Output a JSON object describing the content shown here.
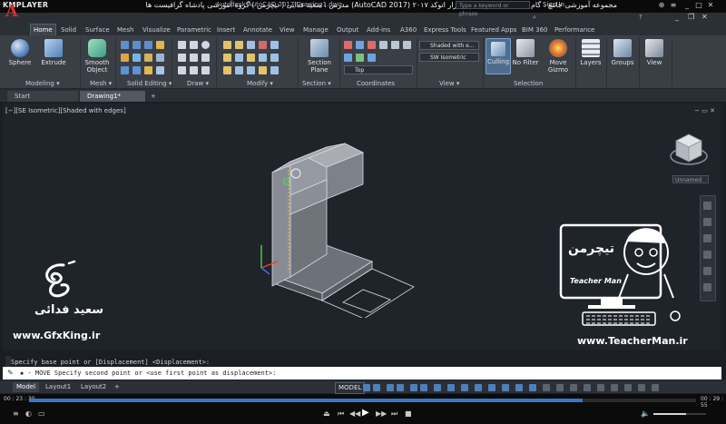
{
  "player": {
    "logo": "KMPLAYER",
    "title": "مجموعه آموزشی جامع ، گام به گام و کاربردی نرم افزار  اتوکد ۲۰۱۷ (AutoCAD 2017)  مدرس : سعید فدایی ( تیچرمن ) گروه آموزشی پادشاه گرافیست ها",
    "current_time": "00 : 23 : 30",
    "total_time": "00 : 29 : 55",
    "progress": 0.83,
    "volume": 0.62,
    "controls": [
      "⏏",
      "⏮",
      "◀◀",
      "▶",
      "▶▶",
      "⏭",
      "■"
    ]
  },
  "acad": {
    "app_letter": "A",
    "title": "Autodesk AutoCAD 2017    Drawing1.dwg",
    "search_placeholder": "Type a keyword or phrase",
    "sign_in": "Sign In",
    "ribbon_tabs": [
      "Home",
      "Solid",
      "Surface",
      "Mesh",
      "Visualize",
      "Parametric",
      "Insert",
      "Annotate",
      "View",
      "Manage",
      "Output",
      "Add-ins",
      "A360",
      "Express Tools",
      "Featured Apps",
      "BIM 360",
      "Performance"
    ],
    "big_buttons": {
      "sphere": "Sphere",
      "extrude": "Extrude",
      "smooth_object": "Smooth\nObject",
      "section_plane": "Section\nPlane",
      "culling": "Culling",
      "no_filter": "No Filter",
      "move_gizmo": "Move\nGizmo",
      "layers": "Layers",
      "groups": "Groups",
      "view": "View"
    },
    "dropdowns": {
      "visual_style": "Shaded with e...",
      "view_preset": "SW Isometric",
      "ucs_top": "Top"
    },
    "panel_titles": [
      "Modeling ▾",
      "Mesh ▾",
      "Solid Editing ▾",
      "Draw ▾",
      "Modify ▾",
      "Section ▾",
      "Coordinates",
      "View ▾",
      "Selection"
    ],
    "doc_tabs": [
      "Start",
      "Drawing1*",
      "+"
    ],
    "viewport_label": "[−][SE Isometric][Shaded with edges]",
    "viewport_controls": "−  ▭  ✕",
    "unnamed": "Unnamed",
    "command_history": "Specify base point or [Displacement] <Displacement>:",
    "command_line": "▪ - MOVE Specify second point or <use first point as displacement>:",
    "layout_tabs": [
      "Model",
      "Layout1",
      "Layout2",
      "+"
    ],
    "model_button": "MODEL"
  },
  "watermarks": {
    "gfx_url": "www.GfxKing.ir",
    "gfx_name": "سعید فدائی",
    "tm_url": "www.TeacherMan.ir",
    "tm_brand": "Teacher Man",
    "tm_logo": "تیچرمن"
  },
  "colors": {
    "accent": "#3a77c4",
    "app_red": "#d3302a"
  }
}
